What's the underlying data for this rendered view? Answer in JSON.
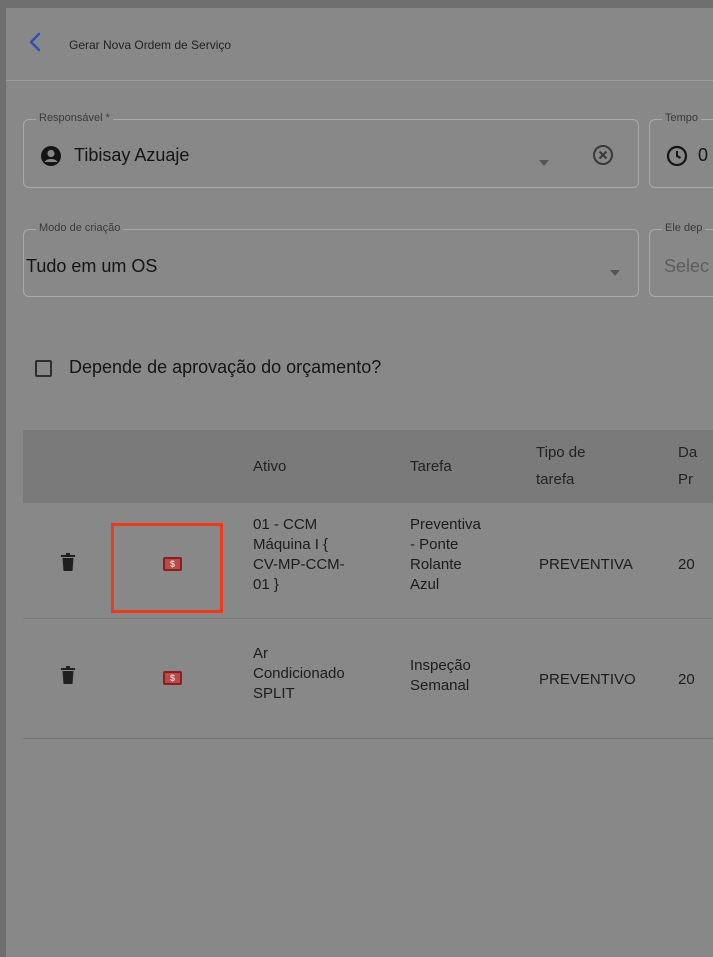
{
  "header": {
    "title": "Gerar Nova Ordem de Serviço"
  },
  "form": {
    "responsavel": {
      "label": "Responsável *",
      "value": "Tibisay  Azuaje"
    },
    "tempo": {
      "label": "Tempo",
      "value": "0"
    },
    "modo": {
      "label": "Modo de criação",
      "value": "Tudo em um OS"
    },
    "depende": {
      "label": "Ele dep",
      "placeholder": "Selec"
    },
    "aprovacao": {
      "label": "Depende de aprovação do orçamento?",
      "checked": false
    }
  },
  "table": {
    "headers": {
      "ativo": "Ativo",
      "tarefa": "Tarefa",
      "tipo_line1": "Tipo de",
      "tipo_line2": "tarefa",
      "data_line1": "Da",
      "data_line2": "Pr"
    },
    "rows": [
      {
        "ativo": [
          "01 - CCM",
          "Máquina I {",
          "CV-MP-CCM-",
          "01 }"
        ],
        "tarefa": [
          "Preventiva",
          "- Ponte",
          "Rolante",
          "Azul"
        ],
        "tipo": "PREVENTIVA",
        "data": "20"
      },
      {
        "ativo": [
          "Ar",
          "Condicionado",
          "SPLIT"
        ],
        "tarefa": [
          "Inspeção",
          "Semanal"
        ],
        "tipo": "PREVENTIVO",
        "data": "20"
      }
    ]
  },
  "icons": {
    "back": "chevron-left-icon",
    "user": "account-circle-icon",
    "clock": "clock-icon",
    "dropdown": "caret-down-icon",
    "clear": "clear-circle-icon",
    "delete": "trash-icon",
    "budget": "dollar-bill-icon"
  },
  "colors": {
    "accent": "#2f4fb8",
    "highlight": "#ee3a1e",
    "budget_icon": "#b84a4a"
  }
}
